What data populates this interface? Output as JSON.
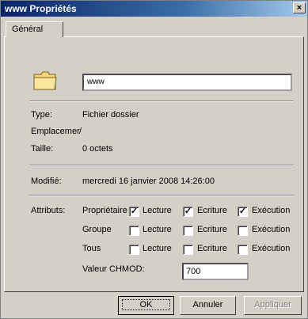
{
  "window": {
    "title": "www Propriétés",
    "close_symbol": "×"
  },
  "tabs": [
    {
      "label": "Général"
    }
  ],
  "folder": {
    "name": "www"
  },
  "info": {
    "type_label": "Type:",
    "type_value": "Fichier dossier",
    "location_label": "Emplacemer",
    "location_value": "/",
    "size_label": "Taille:",
    "size_value": "0 octets"
  },
  "modified": {
    "label": "Modifié:",
    "value": "mercredi 16 janvier 2008 14:26:00"
  },
  "attributes": {
    "label": "Attributs:",
    "groups": [
      {
        "name": "Propriétaire",
        "lecture": true,
        "ecriture": true,
        "execution": true
      },
      {
        "name": "Groupe",
        "lecture": false,
        "ecriture": false,
        "execution": false
      },
      {
        "name": "Tous",
        "lecture": false,
        "ecriture": false,
        "execution": false
      }
    ],
    "perm_labels": {
      "lecture": "Lecture",
      "ecriture": "Ecriture",
      "execution": "Exécution"
    },
    "chmod_label": "Valeur CHMOD:",
    "chmod_value": "700"
  },
  "buttons": {
    "ok": "OK",
    "cancel": "Annuler",
    "apply": "Appliquer"
  },
  "colors": {
    "titlebar_start": "#0a246a",
    "face": "#d4d0c8",
    "folder": "#f7d775"
  }
}
